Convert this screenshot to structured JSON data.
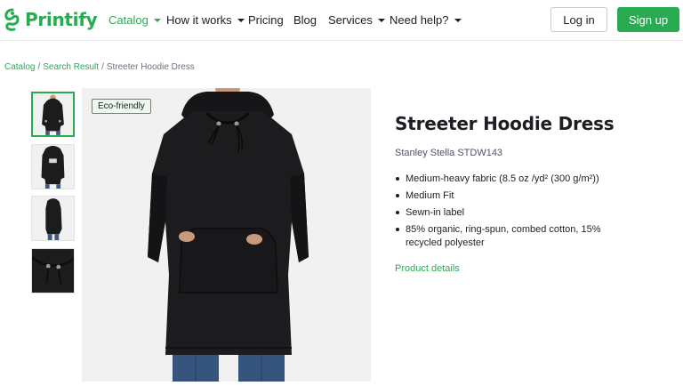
{
  "brand": {
    "name": "Printify",
    "color": "#29ab51"
  },
  "nav": {
    "items": [
      {
        "label": "Catalog",
        "dropdown": true,
        "active": true
      },
      {
        "label": "How it works",
        "dropdown": true,
        "active": false
      },
      {
        "label": "Pricing",
        "dropdown": false,
        "active": false
      },
      {
        "label": "Blog",
        "dropdown": false,
        "active": false
      },
      {
        "label": "Services",
        "dropdown": true,
        "active": false
      },
      {
        "label": "Need help?",
        "dropdown": true,
        "active": false
      }
    ],
    "login_label": "Log in",
    "signup_label": "Sign up"
  },
  "breadcrumb": {
    "items": [
      "Catalog",
      "Search Result"
    ],
    "separator": "/",
    "current": "Streeter Hoodie Dress"
  },
  "gallery": {
    "thumbnails": [
      {
        "view": "front",
        "selected": true
      },
      {
        "view": "back",
        "selected": false
      },
      {
        "view": "side",
        "selected": false
      },
      {
        "view": "detail",
        "selected": false
      }
    ]
  },
  "badge": {
    "label": "Eco-friendly"
  },
  "product": {
    "title": "Streeter Hoodie Dress",
    "brand_model": "Stanley Stella STDW143",
    "features": [
      "Medium-heavy fabric (8.5 oz /yd² (300 g/m²))",
      "Medium Fit",
      "Sewn-in label",
      "85% organic, ring-spun, combed cotton, 15% recycled polyester"
    ],
    "details_link": "Product details"
  },
  "colors": {
    "accent": "#29ab51",
    "text": "#1b1e23",
    "muted": "#6b7280",
    "image_bg": "#f1f1f1",
    "garment": "#1c1c1e"
  }
}
